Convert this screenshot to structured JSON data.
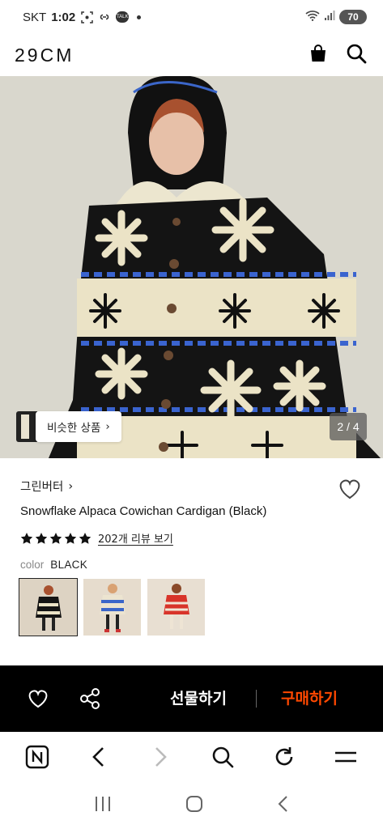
{
  "status_bar": {
    "carrier": "SKT",
    "time": "1:02",
    "battery": "70",
    "icons": [
      "screenshot-icon",
      "link-icon",
      "talk-icon",
      "notification-dot",
      "wifi-icon",
      "signal-icon",
      "battery-icon"
    ],
    "talk_label": "TALK"
  },
  "header": {
    "logo": "29CM",
    "icons": [
      "shopping-bag-icon",
      "search-icon"
    ]
  },
  "gallery": {
    "similar_button_label": "비슷한 상품",
    "similar_button_chevron": "›",
    "page_indicator": "2 / 4"
  },
  "product": {
    "brand": "그린버터",
    "brand_chevron": "›",
    "name": "Snowflake Alpaca Cowichan Cardigan (Black)",
    "stars": 5,
    "review_link": "202개 리뷰 보기",
    "color_label": "color",
    "color_value": "BLACK",
    "swatches": [
      {
        "name": "black",
        "selected": true
      },
      {
        "name": "blue",
        "selected": false
      },
      {
        "name": "red",
        "selected": false
      }
    ]
  },
  "action_bar": {
    "gift_label": "선물하기",
    "buy_label": "구매하기",
    "buy_color": "#ff4800"
  },
  "browser_bar": {
    "items": [
      "naver-icon",
      "back-icon",
      "forward-icon",
      "search-icon",
      "refresh-icon",
      "menu-icon"
    ]
  },
  "android_nav": {
    "items": [
      "recent-apps-icon",
      "home-icon",
      "back-icon"
    ]
  }
}
